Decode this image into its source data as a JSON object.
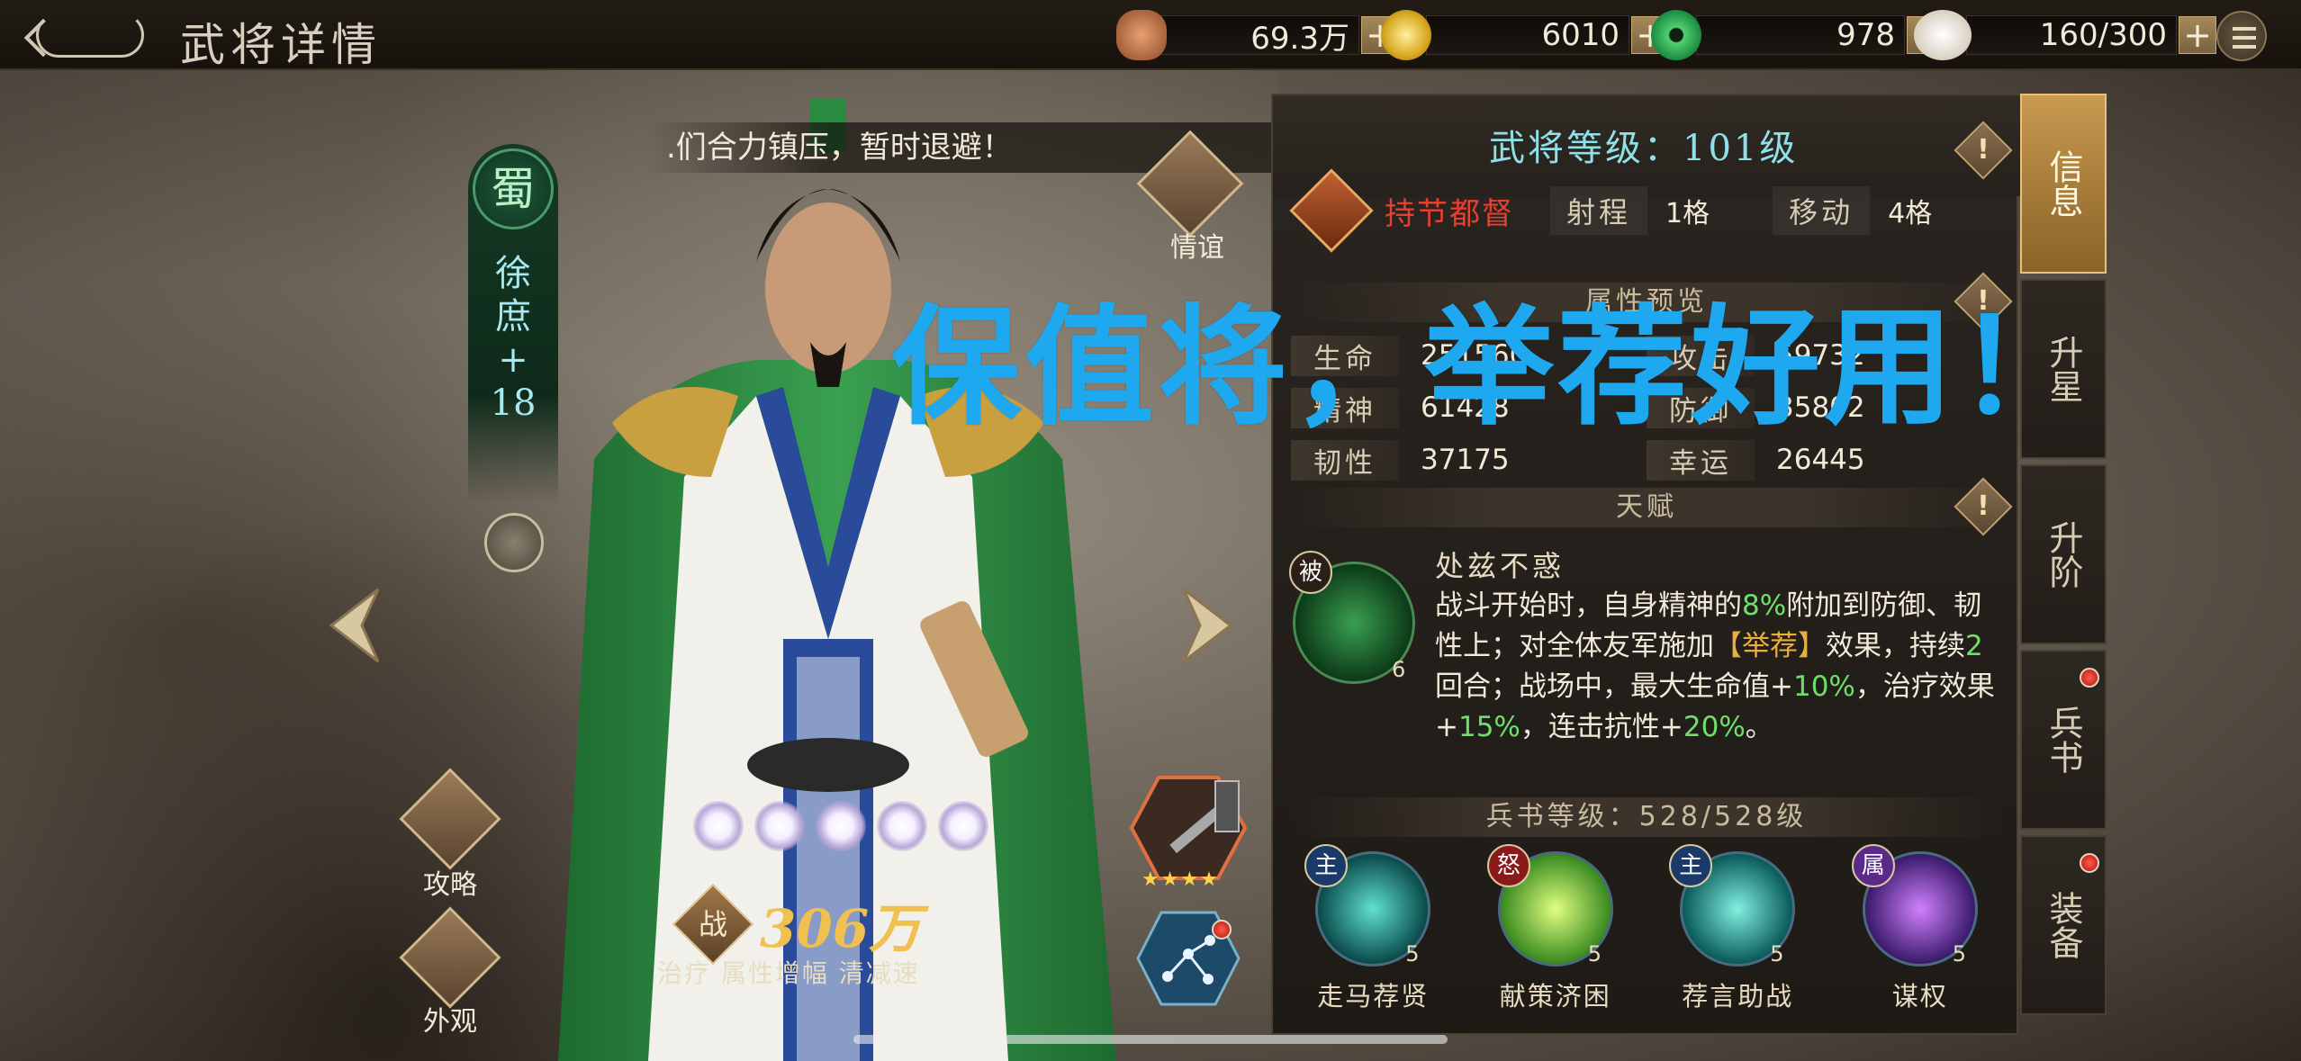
{
  "header": {
    "title": "武将详情",
    "resources": [
      {
        "icon": "coin-stack-icon",
        "value": "69.3万"
      },
      {
        "icon": "gold-coin-icon",
        "value": "6010"
      },
      {
        "icon": "jade-icon",
        "value": "978"
      },
      {
        "icon": "steamed-bun-icon",
        "value": "160/300"
      }
    ],
    "plus": "+"
  },
  "hero": {
    "faction": "蜀",
    "name_lines": [
      "徐",
      "庶",
      "+",
      "18"
    ],
    "dialogue": ".们合力镇压，暂时退避！",
    "friendship_label": "情谊",
    "strategy_label": "攻略",
    "appearance_label": "外观",
    "power_badge": "战",
    "power": "306万",
    "tags": "治疗 属性增幅 清减速",
    "weapon_stars": "★★★★"
  },
  "panel": {
    "level": "武将等级：101级",
    "warn_mark": "!",
    "class_name": "持节都督",
    "range_label": "射程",
    "range_value": "1格",
    "move_label": "移动",
    "move_value": "4格",
    "attr_section": "属性预览",
    "stats": [
      {
        "label": "生命",
        "value": "251560"
      },
      {
        "label": "攻击",
        "value": "59732"
      },
      {
        "label": "精神",
        "value": "61428"
      },
      {
        "label": "防御",
        "value": "35802"
      },
      {
        "label": "韧性",
        "value": "37175"
      },
      {
        "label": "幸运",
        "value": "26445"
      }
    ],
    "talent_section": "天赋",
    "talent_badge": "被",
    "talent_level": "6",
    "talent_name": "处兹不惑",
    "talent_desc": {
      "p1": "战斗开始时，自身精神的",
      "g1": "8%",
      "p2": "附加到防御、韧性上；对全体友军施加",
      "o1": "【举荐】",
      "p3": "效果，持续",
      "g2": "2",
      "p4": "回合；战场中，最大生命值+",
      "g3": "10%",
      "p5": "，治疗效果+",
      "g4": "15%",
      "p6": "，连击抗性+",
      "g5": "20%",
      "p7": "。"
    },
    "book_section": "兵书等级：528/528级",
    "skills": [
      {
        "badge": "主",
        "name": "走马荐贤",
        "level": "5"
      },
      {
        "badge": "怒",
        "name": "献策济困",
        "level": "5"
      },
      {
        "badge": "主",
        "name": "荐言助战",
        "level": "5"
      },
      {
        "badge": "属",
        "name": "谋权",
        "level": "5"
      }
    ]
  },
  "tabs": [
    "信息",
    "升星",
    "升阶",
    "兵书",
    "装备"
  ],
  "caption": "保值将，举荐好用！"
}
